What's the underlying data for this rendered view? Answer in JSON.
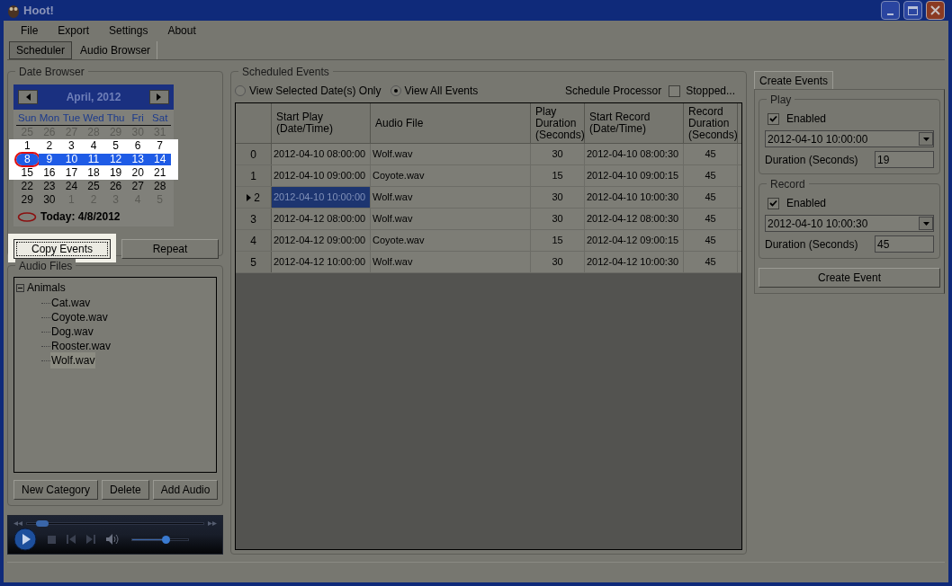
{
  "window": {
    "title": "Hoot!"
  },
  "menu": [
    "File",
    "Export",
    "Settings",
    "About"
  ],
  "tabs": [
    {
      "label": "Scheduler",
      "selected": true
    },
    {
      "label": "Audio Browser",
      "selected": false
    }
  ],
  "date_browser": {
    "title": "Date Browser",
    "month": "April, 2012",
    "weekdays": [
      "Sun",
      "Mon",
      "Tue",
      "Wed",
      "Thu",
      "Fri",
      "Sat"
    ],
    "weeks": [
      {
        "selected": false,
        "highlighted": false,
        "days": [
          {
            "label": "25",
            "other_month": true,
            "today": false
          },
          {
            "label": "26",
            "other_month": true,
            "today": false
          },
          {
            "label": "27",
            "other_month": true,
            "today": false
          },
          {
            "label": "28",
            "other_month": true,
            "today": false
          },
          {
            "label": "29",
            "other_month": true,
            "today": false
          },
          {
            "label": "30",
            "other_month": true,
            "today": false
          },
          {
            "label": "31",
            "other_month": true,
            "today": false
          }
        ]
      },
      {
        "selected": false,
        "highlighted": true,
        "days": [
          {
            "label": "1",
            "other_month": false,
            "today": false
          },
          {
            "label": "2",
            "other_month": false,
            "today": false
          },
          {
            "label": "3",
            "other_month": false,
            "today": false
          },
          {
            "label": "4",
            "other_month": false,
            "today": false
          },
          {
            "label": "5",
            "other_month": false,
            "today": false
          },
          {
            "label": "6",
            "other_month": false,
            "today": false
          },
          {
            "label": "7",
            "other_month": false,
            "today": false
          }
        ]
      },
      {
        "selected": true,
        "highlighted": true,
        "days": [
          {
            "label": "8",
            "other_month": false,
            "today": true
          },
          {
            "label": "9",
            "other_month": false,
            "today": false
          },
          {
            "label": "10",
            "other_month": false,
            "today": false
          },
          {
            "label": "11",
            "other_month": false,
            "today": false
          },
          {
            "label": "12",
            "other_month": false,
            "today": false
          },
          {
            "label": "13",
            "other_month": false,
            "today": false
          },
          {
            "label": "14",
            "other_month": false,
            "today": false
          }
        ]
      },
      {
        "selected": false,
        "highlighted": true,
        "days": [
          {
            "label": "15",
            "other_month": false,
            "today": false
          },
          {
            "label": "16",
            "other_month": false,
            "today": false
          },
          {
            "label": "17",
            "other_month": false,
            "today": false
          },
          {
            "label": "18",
            "other_month": false,
            "today": false
          },
          {
            "label": "19",
            "other_month": false,
            "today": false
          },
          {
            "label": "20",
            "other_month": false,
            "today": false
          },
          {
            "label": "21",
            "other_month": false,
            "today": false
          }
        ]
      },
      {
        "selected": false,
        "highlighted": false,
        "days": [
          {
            "label": "22",
            "other_month": false,
            "today": false
          },
          {
            "label": "23",
            "other_month": false,
            "today": false
          },
          {
            "label": "24",
            "other_month": false,
            "today": false
          },
          {
            "label": "25",
            "other_month": false,
            "today": false
          },
          {
            "label": "26",
            "other_month": false,
            "today": false
          },
          {
            "label": "27",
            "other_month": false,
            "today": false
          },
          {
            "label": "28",
            "other_month": false,
            "today": false
          }
        ]
      },
      {
        "selected": false,
        "highlighted": false,
        "days": [
          {
            "label": "29",
            "other_month": false,
            "today": false
          },
          {
            "label": "30",
            "other_month": false,
            "today": false
          },
          {
            "label": "1",
            "other_month": true,
            "today": false
          },
          {
            "label": "2",
            "other_month": true,
            "today": false
          },
          {
            "label": "3",
            "other_month": true,
            "today": false
          },
          {
            "label": "4",
            "other_month": true,
            "today": false
          },
          {
            "label": "5",
            "other_month": true,
            "today": false
          }
        ]
      }
    ],
    "today_label": "Today: 4/8/2012",
    "buttons": [
      {
        "label": "Copy Events",
        "highlighted": true
      },
      {
        "label": "Repeat",
        "highlighted": false
      }
    ]
  },
  "audio_files": {
    "title": "Audio Files",
    "tree": [
      {
        "label": "Animals",
        "expanded": true,
        "children": [
          {
            "label": "Cat.wav",
            "selected": false
          },
          {
            "label": "Coyote.wav",
            "selected": false
          },
          {
            "label": "Dog.wav",
            "selected": false
          },
          {
            "label": "Rooster.wav",
            "selected": false
          },
          {
            "label": "Wolf.wav",
            "selected": true
          }
        ]
      }
    ],
    "buttons": [
      "New Category",
      "Delete",
      "Add Audio"
    ]
  },
  "player": {
    "seek": {
      "level": 0.05
    },
    "volume": {
      "level": 0.6
    }
  },
  "scheduled_events": {
    "title": "Scheduled Events",
    "view_options": [
      {
        "label": "View Selected Date(s) Only",
        "selected": false
      },
      {
        "label": "View All Events",
        "selected": true
      }
    ],
    "processor": {
      "label": "Schedule Processor",
      "checked": false,
      "status": "Stopped..."
    },
    "columns": [
      "Start Play (Date/Time)",
      "Audio File",
      "Play Duration (Seconds)",
      "Start Record (Date/Time)",
      "Record Duration (Seconds)"
    ],
    "rows": [
      {
        "index": "0",
        "selected": false,
        "cells": [
          "2012-04-10 08:00:00",
          "Wolf.wav",
          "30",
          "2012-04-10 08:00:30",
          "45"
        ]
      },
      {
        "index": "1",
        "selected": false,
        "cells": [
          "2012-04-10 09:00:00",
          "Coyote.wav",
          "15",
          "2012-04-10 09:00:15",
          "45"
        ]
      },
      {
        "index": "2",
        "selected": true,
        "cells": [
          "2012-04-10 10:00:00",
          "Wolf.wav",
          "30",
          "2012-04-10 10:00:30",
          "45"
        ]
      },
      {
        "index": "3",
        "selected": false,
        "cells": [
          "2012-04-12 08:00:00",
          "Wolf.wav",
          "30",
          "2012-04-12 08:00:30",
          "45"
        ]
      },
      {
        "index": "4",
        "selected": false,
        "cells": [
          "2012-04-12 09:00:00",
          "Coyote.wav",
          "15",
          "2012-04-12 09:00:15",
          "45"
        ]
      },
      {
        "index": "5",
        "selected": false,
        "cells": [
          "2012-04-12 10:00:00",
          "Wolf.wav",
          "30",
          "2012-04-12 10:00:30",
          "45"
        ]
      }
    ]
  },
  "create_events": {
    "tab": "Create Events",
    "groups": [
      {
        "title": "Play",
        "enabled_label": "Enabled",
        "enabled": true,
        "datetime": "2012-04-10 10:00:00",
        "duration_label": "Duration (Seconds)",
        "duration": "19"
      },
      {
        "title": "Record",
        "enabled_label": "Enabled",
        "enabled": true,
        "datetime": "2012-04-10 10:00:30",
        "duration_label": "Duration (Seconds)",
        "duration": "45"
      }
    ],
    "button": "Create Event"
  }
}
